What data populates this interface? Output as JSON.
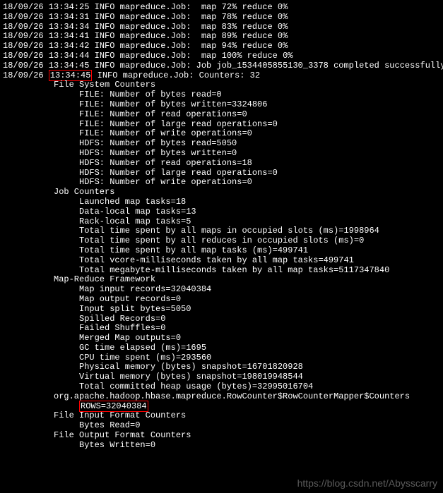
{
  "progress": [
    "18/09/26 13:34:25 INFO mapreduce.Job:  map 72% reduce 0%",
    "18/09/26 13:34:31 INFO mapreduce.Job:  map 78% reduce 0%",
    "18/09/26 13:34:34 INFO mapreduce.Job:  map 83% reduce 0%",
    "18/09/26 13:34:41 INFO mapreduce.Job:  map 89% reduce 0%",
    "18/09/26 13:34:42 INFO mapreduce.Job:  map 94% reduce 0%",
    "18/09/26 13:34:44 INFO mapreduce.Job:  map 100% reduce 0%",
    "18/09/26 13:34:45 INFO mapreduce.Job: Job job_1534405855130_3378 completed successfully"
  ],
  "counters_line": {
    "prefix": "18/09/26 ",
    "boxed": "13:34:45",
    "suffix": " INFO mapreduce.Job: Counters: 32"
  },
  "sections": {
    "fs_header": "File System Counters",
    "fs": [
      "FILE: Number of bytes read=0",
      "FILE: Number of bytes written=3324806",
      "FILE: Number of read operations=0",
      "FILE: Number of large read operations=0",
      "FILE: Number of write operations=0",
      "HDFS: Number of bytes read=5050",
      "HDFS: Number of bytes written=0",
      "HDFS: Number of read operations=18",
      "HDFS: Number of large read operations=0",
      "HDFS: Number of write operations=0"
    ],
    "job_header": "Job Counters",
    "job": [
      "Launched map tasks=18",
      "Data-local map tasks=13",
      "Rack-local map tasks=5",
      "Total time spent by all maps in occupied slots (ms)=1998964",
      "Total time spent by all reduces in occupied slots (ms)=0",
      "Total time spent by all map tasks (ms)=499741",
      "Total vcore-milliseconds taken by all map tasks=499741",
      "Total megabyte-milliseconds taken by all map tasks=5117347840"
    ],
    "mrf_header": "Map-Reduce Framework",
    "mrf": [
      "Map input records=32040384",
      "Map output records=0",
      "Input split bytes=5050",
      "Spilled Records=0",
      "Failed Shuffles=0",
      "Merged Map outputs=0",
      "GC time elapsed (ms)=1695",
      "CPU time spent (ms)=293560",
      "Physical memory (bytes) snapshot=16701820928",
      "Virtual memory (bytes) snapshot=198019948544",
      "Total committed heap usage (bytes)=32995016704"
    ],
    "rowcounter_header": "org.apache.hadoop.hbase.mapreduce.RowCounter$RowCounterMapper$Counters",
    "rowcounter_value": "ROWS=32040384",
    "fif_header": "File Input Format Counters",
    "fif": [
      "Bytes Read=0"
    ],
    "fof_header": "File Output Format Counters",
    "fof": [
      "Bytes Written=0"
    ]
  },
  "watermark": "https://blog.csdn.net/Abysscarry"
}
